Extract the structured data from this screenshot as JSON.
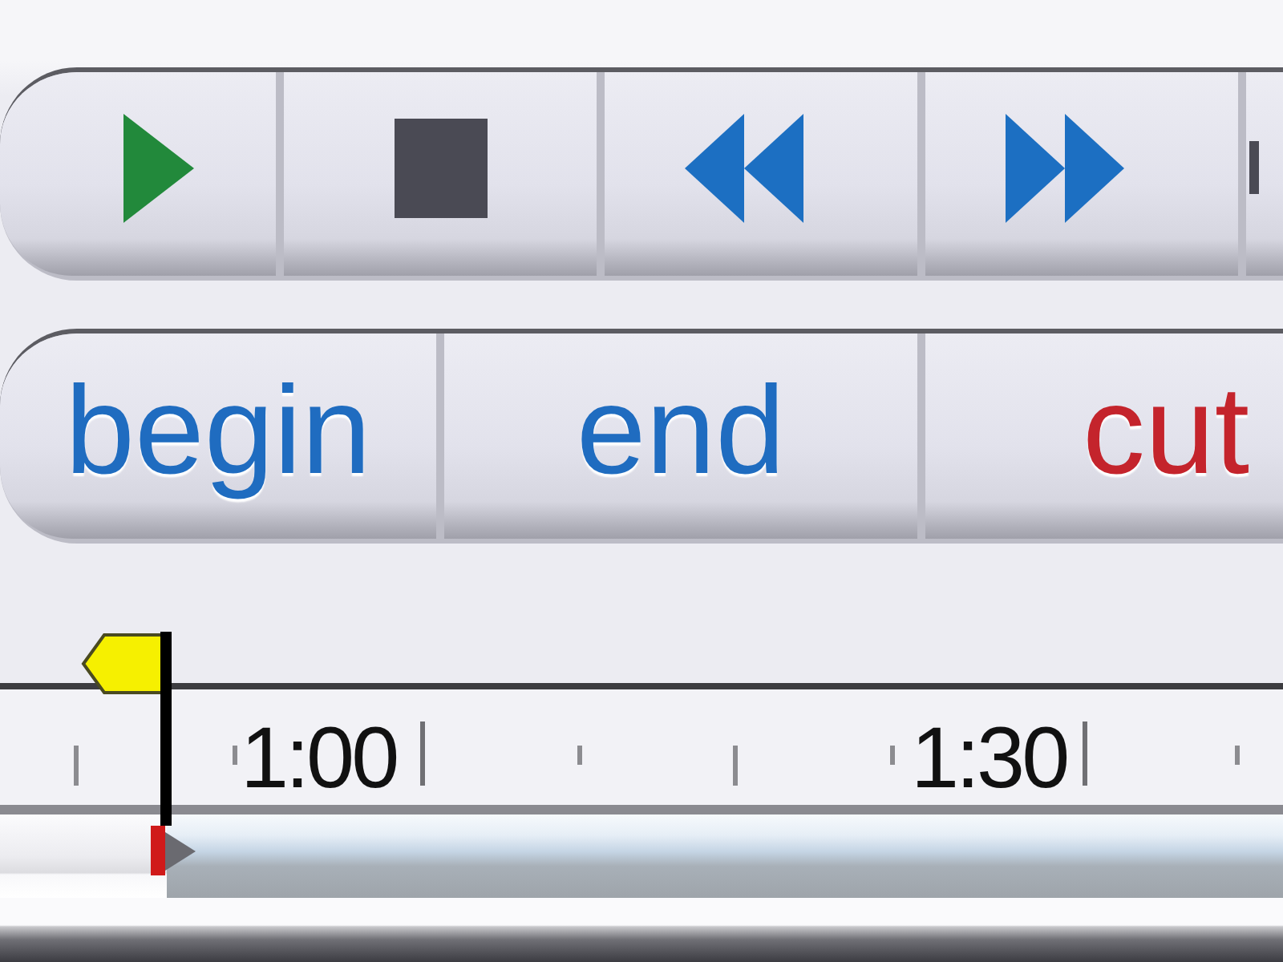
{
  "transport_buttons": [
    {
      "kind": "play"
    },
    {
      "kind": "stop"
    },
    {
      "kind": "rewind"
    },
    {
      "kind": "fast_forward"
    },
    {
      "kind": "clipped"
    }
  ],
  "edit_buttons": [
    {
      "label": "begin",
      "color": "#1f6cc0"
    },
    {
      "label": "end",
      "color": "#1f6cc0"
    },
    {
      "label": "cut",
      "color": "#c4242c"
    }
  ],
  "timeline": {
    "labels": [
      "1:00",
      "1:30"
    ],
    "playhead": {
      "level": 0.13
    }
  }
}
